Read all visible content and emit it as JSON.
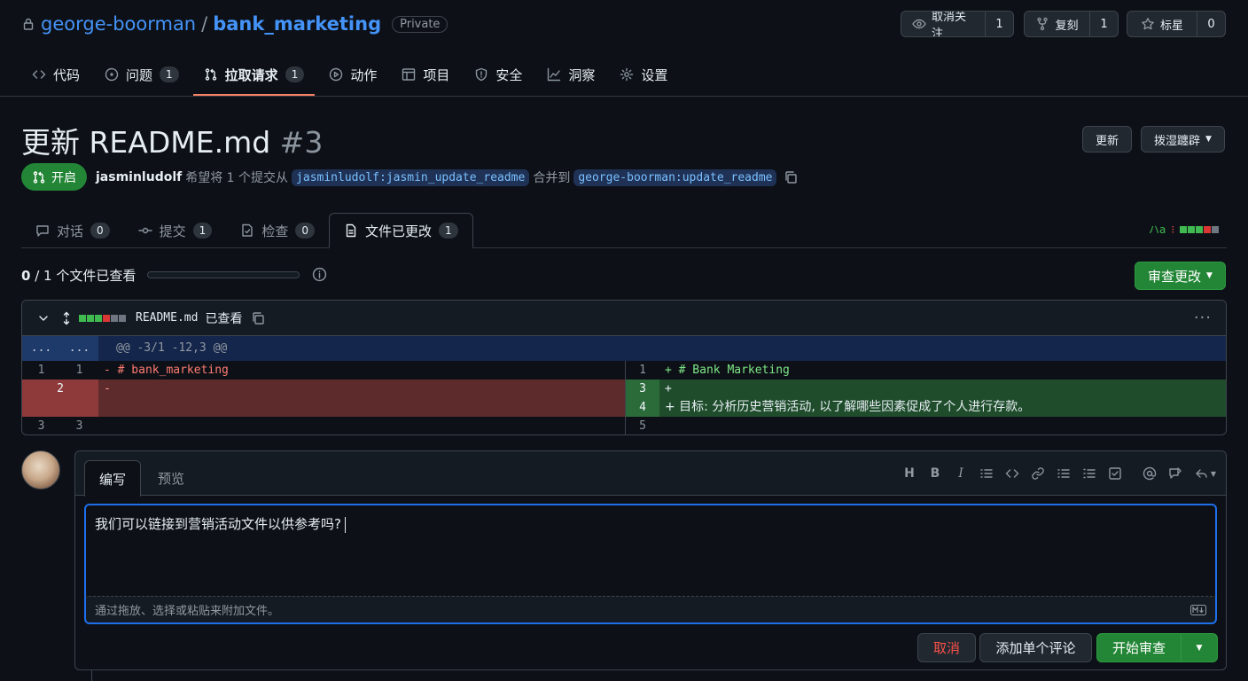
{
  "repo": {
    "owner": "george-boorman",
    "separator": "/",
    "name": "bank_marketing",
    "visibility": "Private"
  },
  "header_buttons": {
    "watch": {
      "label": "取消关注",
      "count": "1"
    },
    "fork": {
      "label": "复刻",
      "count": "1"
    },
    "star": {
      "label": "标星",
      "count": "0"
    }
  },
  "nav": [
    {
      "label": "代码",
      "icon": "code-icon"
    },
    {
      "label": "问题",
      "icon": "issue-icon",
      "count": "1"
    },
    {
      "label": "拉取请求",
      "icon": "pull-request-icon",
      "count": "1",
      "active": true
    },
    {
      "label": "动作",
      "icon": "play-icon"
    },
    {
      "label": "项目",
      "icon": "table-icon"
    },
    {
      "label": "安全",
      "icon": "shield-icon"
    },
    {
      "label": "洞察",
      "icon": "graph-icon"
    },
    {
      "label": "设置",
      "icon": "gear-icon"
    }
  ],
  "pr": {
    "title": "更新 README.md",
    "number": "#3",
    "state": "开启",
    "author": "jasminludolf",
    "meta_text": "希望将 1 个提交从",
    "head_branch": "jasminludolf:jasmin_update_readme",
    "merge_text": "合并到",
    "base_branch": "george-boorman:update_readme",
    "update_button": "更新",
    "dropdown_button": "拨湿躔辟"
  },
  "pr_tabs": [
    {
      "label": "对话",
      "count": "0"
    },
    {
      "label": "提交",
      "count": "1"
    },
    {
      "label": "检查",
      "count": "0"
    },
    {
      "label": "文件已更改",
      "count": "1",
      "active": true
    }
  ],
  "diffstat_top": "ハa",
  "viewed": {
    "count": "0",
    "total_text": "/ 1 个文件已查看"
  },
  "review_button": "审查更改",
  "file": {
    "name": "README.md",
    "viewed_label": "已查看",
    "hunk": "@@ -3/1 -12,3 @@",
    "expand_left": "...",
    "expand_right": "...",
    "left": [
      {
        "old": "1",
        "new": "1",
        "text": "- # bank_marketing",
        "type": "context"
      },
      {
        "old": "2",
        "new": "",
        "text": "-",
        "type": "deleted"
      },
      {
        "old": "3",
        "new": "3",
        "text": "",
        "type": "context"
      }
    ],
    "right": [
      {
        "num": "1",
        "text": "+ # Bank Marketing",
        "type": "context"
      },
      {
        "num": "3",
        "text": "+",
        "type": "added"
      },
      {
        "num": "4",
        "text": "+ 目标: 分析历史营销活动, 以了解哪些因素促成了个人进行存款。",
        "type": "added"
      },
      {
        "num": "5",
        "text": "",
        "type": "context"
      }
    ]
  },
  "comment": {
    "tab_write": "编写",
    "tab_preview": "预览",
    "text": "我们可以链接到营销活动文件以供参考吗?",
    "attach_hint": "通过拖放、选择或粘贴来附加文件。",
    "cancel": "取消",
    "single_comment": "添加单个评论",
    "start_review": "开始审查"
  },
  "colors": {
    "accent": "#4493f8",
    "green": "#238636",
    "deleted_bg": "#5d2b2b",
    "added_bg": "#1f4d2b",
    "danger": "#f85149"
  }
}
